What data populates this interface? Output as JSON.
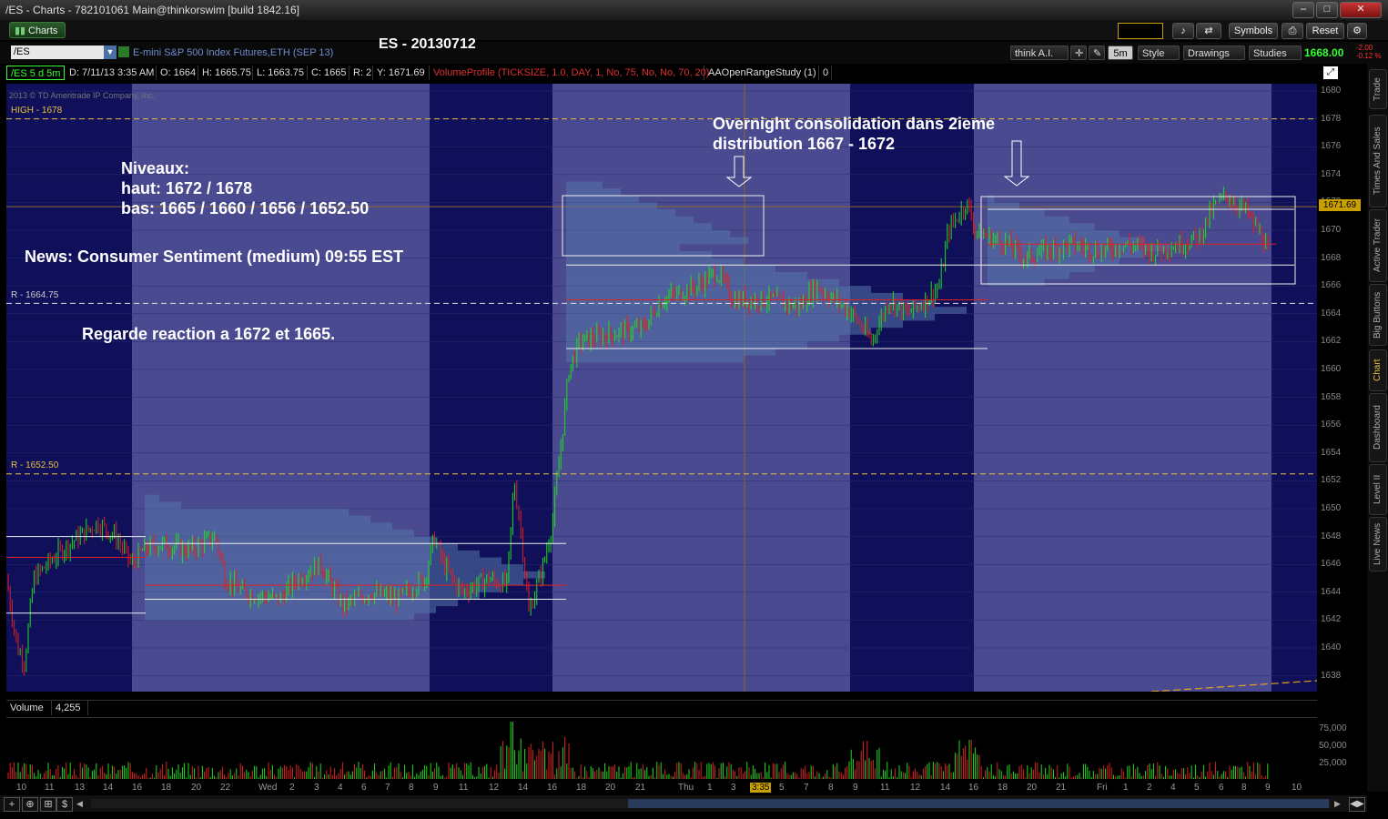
{
  "window": {
    "title": "/ES - Charts - 782101061 Main@thinkorswim [build 1842.16]",
    "tab_label": "Charts",
    "buttons": [
      "Symbols",
      "Reset"
    ]
  },
  "symbol_bar": {
    "symbol": "/ES",
    "description": "E-mini S&P 500 Index Futures,ETH (SEP 13)",
    "chart_title": "ES - 20130712",
    "think_ai": "think A.I.",
    "timeframe": "5m",
    "style": "Style",
    "drawings": "Drawings",
    "studies": "Studies",
    "last_price": "1668.00",
    "change": "-2.00",
    "change_pct": "-0.12 %"
  },
  "info_bar": {
    "series": "/ES 5 d 5m",
    "date": "D: 7/11/13 3:35 AM",
    "open": "O: 1664",
    "high": "H: 1665.75",
    "low": "L: 1663.75",
    "close": "C: 1665",
    "range": "R: 2",
    "y": "Y: 1671.69",
    "volume_profile": "VolumeProfile (TICKSIZE, 1.0, DAY, 1, No, 75, No, No, 70, 20)",
    "aa_study": "AAOpenRangeStudy (1)",
    "aa_value": "0"
  },
  "chart": {
    "copyright": "2013 © TD Ameritrade IP Company, Inc.",
    "high_label": "HIGH - 1678",
    "r1_label": "R - 1664.75",
    "r2_label": "R - 1652.50",
    "cursor_price": "1671.69",
    "annotations": {
      "niveaux_1": "Niveaux:",
      "niveaux_2": "haut: 1672 /  1678",
      "niveaux_3": "bas: 1665 / 1660 / 1656 / 1652.50",
      "news": "News: Consumer Sentiment (medium) 09:55 EST",
      "regarde": "Regarde reaction a 1672 et 1665.",
      "overnight_1": "Overnight consolidation dans 2ieme",
      "overnight_2": "distribution 1667 - 1672"
    },
    "y_ticks": [
      "1680",
      "1678",
      "1676",
      "1674",
      "1672",
      "1670",
      "1668",
      "1666",
      "1664",
      "1662",
      "1660",
      "1658",
      "1656",
      "1654",
      "1652",
      "1650",
      "1648",
      "1646",
      "1644",
      "1642",
      "1640",
      "1638"
    ],
    "volume_label": "Volume",
    "volume_value": "4,255",
    "volume_ticks": [
      "75,000",
      "50,000",
      "25,000"
    ],
    "x_ticks": [
      "10",
      "11",
      "13",
      "14",
      "16",
      "18",
      "20",
      "22",
      "Wed",
      "2",
      "3",
      "4",
      "6",
      "7",
      "8",
      "9",
      "11",
      "12",
      "14",
      "16",
      "18",
      "20",
      "21",
      "Thu",
      "1",
      "3",
      "3:35",
      "5",
      "7",
      "8",
      "9",
      "11",
      "12",
      "14",
      "16",
      "18",
      "20",
      "21",
      "Fri",
      "1",
      "2",
      "4",
      "5",
      "6",
      "8",
      "9",
      "10"
    ]
  },
  "right_tabs": [
    "Trade",
    "Times And Sales",
    "Active Trader",
    "Big Buttons",
    "Chart",
    "Dashboard",
    "Level II",
    "Live News"
  ]
}
